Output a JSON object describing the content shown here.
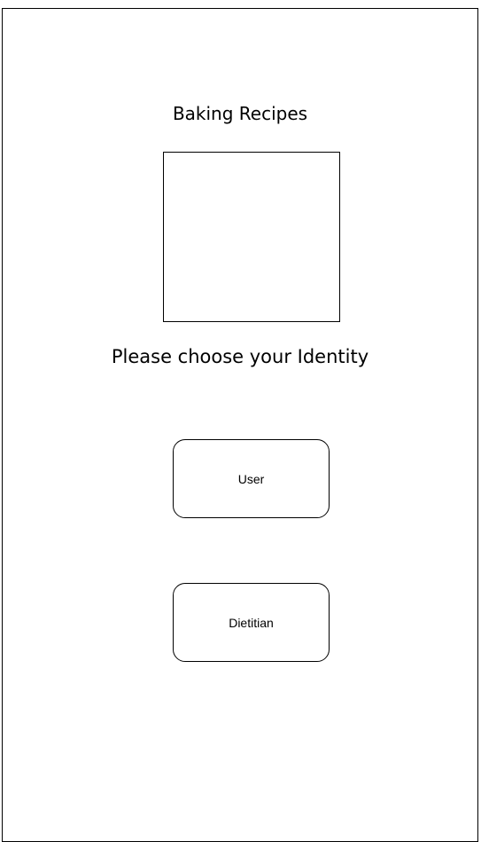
{
  "app": {
    "title": "Baking Recipes",
    "prompt": "Please choose your Identity"
  },
  "roles": {
    "user_label": "User",
    "dietitian_label": "Dietitian"
  }
}
